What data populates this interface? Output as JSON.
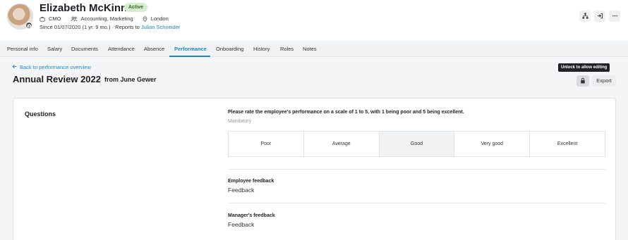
{
  "profile": {
    "name": "Elizabeth McKinnon",
    "status": "Active",
    "role": "CMO",
    "departments": "Accounting, Marketing",
    "location": "London",
    "since": "Since 01/07/2020 (1 yr. 9 mo.)",
    "reports_to_label": "· Reports to",
    "reports_to": "Julian Schneider"
  },
  "header_actions": [
    "org-chart-icon",
    "sign-in-icon",
    "more-icon"
  ],
  "tabs": [
    {
      "label": "Personal info"
    },
    {
      "label": "Salary"
    },
    {
      "label": "Documents"
    },
    {
      "label": "Attendance"
    },
    {
      "label": "Absence"
    },
    {
      "label": "Performance",
      "active": true
    },
    {
      "label": "Onboarding"
    },
    {
      "label": "History"
    },
    {
      "label": "Roles"
    },
    {
      "label": "Notes"
    }
  ],
  "review": {
    "back_link": "Back to performance overview",
    "title": "Annual Review 2022",
    "from": "from June Gewer",
    "tooltip": "Unlock to allow editing",
    "export_label": "Export"
  },
  "questions": {
    "section_title": "Questions",
    "prompt": "Please rate the employee's performance on a scale of 1 to 5, with 1 being poor and 5 being excellent.",
    "mandatory": "Mandatory",
    "scale": [
      "Poor",
      "Average",
      "Good",
      "Very good",
      "Excellent"
    ],
    "selected": "Good",
    "employee_feedback_label": "Employee feedback",
    "employee_feedback_value": "Feedback",
    "manager_feedback_label": "Manager's feedback",
    "manager_feedback_value": "Feedback"
  },
  "colors": {
    "accent": "#1a8ac8",
    "status_active_bg": "#d8ecd0",
    "status_active_text": "#2f6a25"
  }
}
